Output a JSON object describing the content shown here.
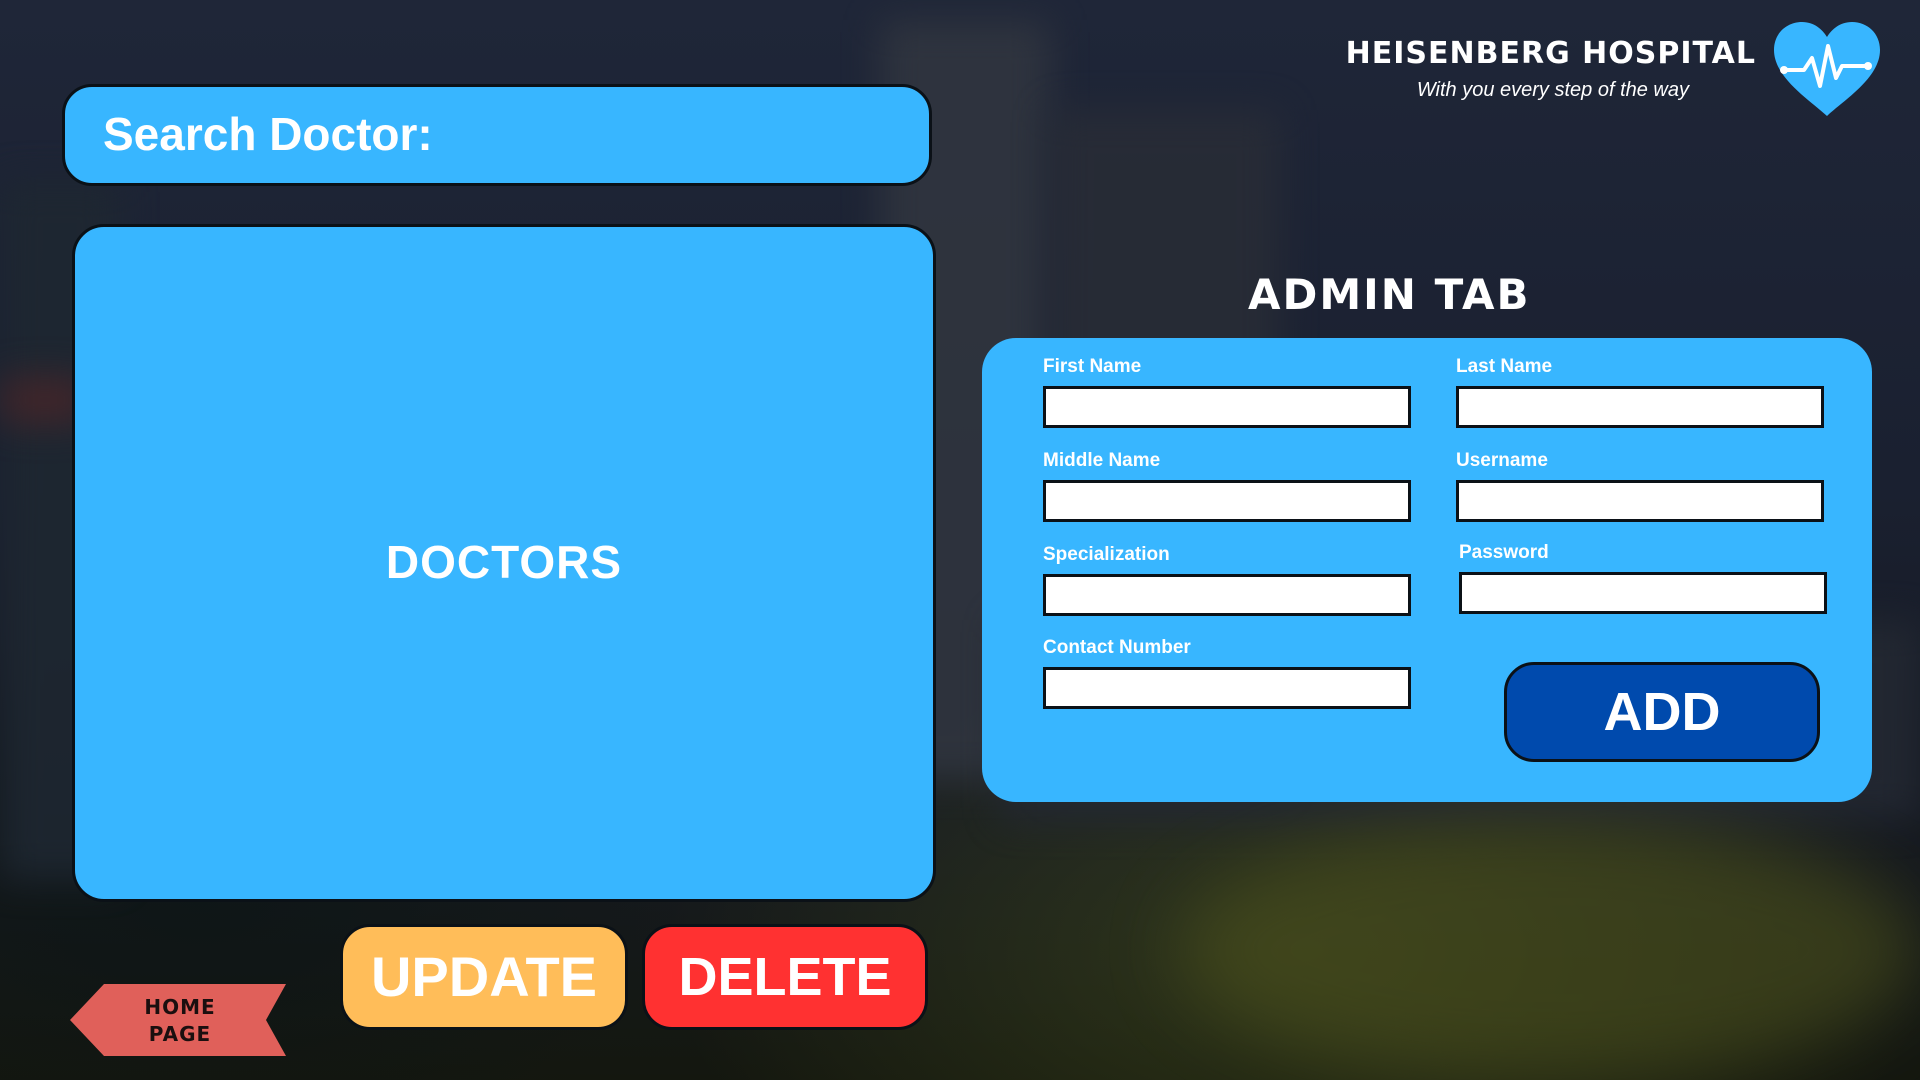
{
  "brand": {
    "title": "HEISENBERG HOSPITAL",
    "tagline": "With you every step of the way",
    "logo_icon": "heart-pulse-icon",
    "logo_color": "#38b6ff"
  },
  "search": {
    "label": "Search Doctor:",
    "value": ""
  },
  "doctors_panel": {
    "label": "DOCTORS"
  },
  "actions": {
    "update_label": "UPDATE",
    "delete_label": "DELETE",
    "home_line1": "HOME",
    "home_line2": "PAGE"
  },
  "admin": {
    "title": "ADMIN TAB",
    "fields": {
      "first_name": "First Name",
      "last_name": "Last Name",
      "middle_name": "Middle Name",
      "username": "Username",
      "specialization": "Specialization",
      "password": "Password",
      "contact_number": "Contact Number"
    },
    "add_label": "ADD"
  },
  "colors": {
    "panel_blue": "#38b6ff",
    "update_orange": "#ffbd59",
    "delete_red": "#ff3131",
    "add_navy": "#004aad",
    "home_red": "#e0605a"
  }
}
